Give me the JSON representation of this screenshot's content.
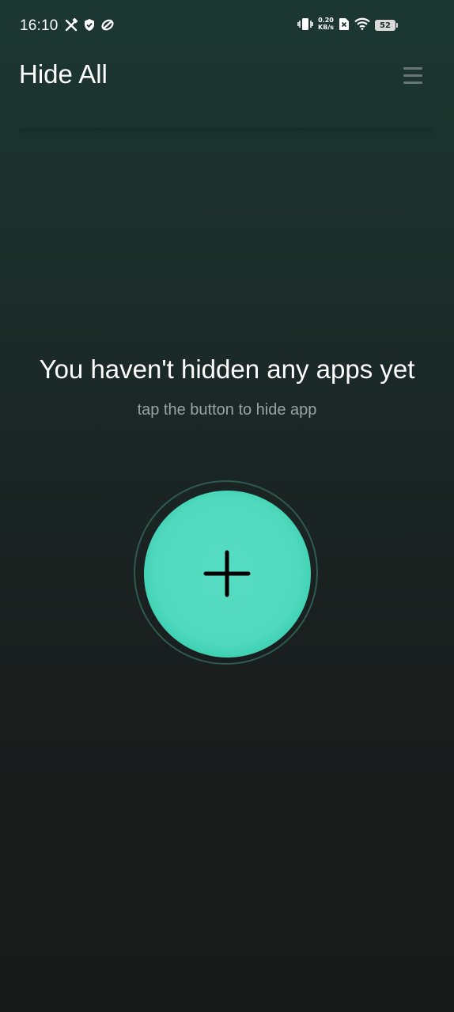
{
  "status_bar": {
    "time": "16:10",
    "left_icons": [
      "tools-icon",
      "shield-icon",
      "sync-icon"
    ],
    "net_speed_value": "0.20",
    "net_speed_unit": "KB/s",
    "right_icons": [
      "vibrate-icon",
      "no-sim-icon",
      "wifi-icon"
    ],
    "battery": "52"
  },
  "header": {
    "title": "Hide All",
    "menu_icon": "hamburger-menu-icon"
  },
  "empty_state": {
    "title": "You haven't hidden any apps yet",
    "subtitle": "tap the button to hide app"
  },
  "add_button": {
    "icon": "plus-icon",
    "color": "#51d9be"
  },
  "colors": {
    "accent": "#51d9be",
    "background_top": "#1c3732",
    "background_bottom": "#181a19"
  }
}
